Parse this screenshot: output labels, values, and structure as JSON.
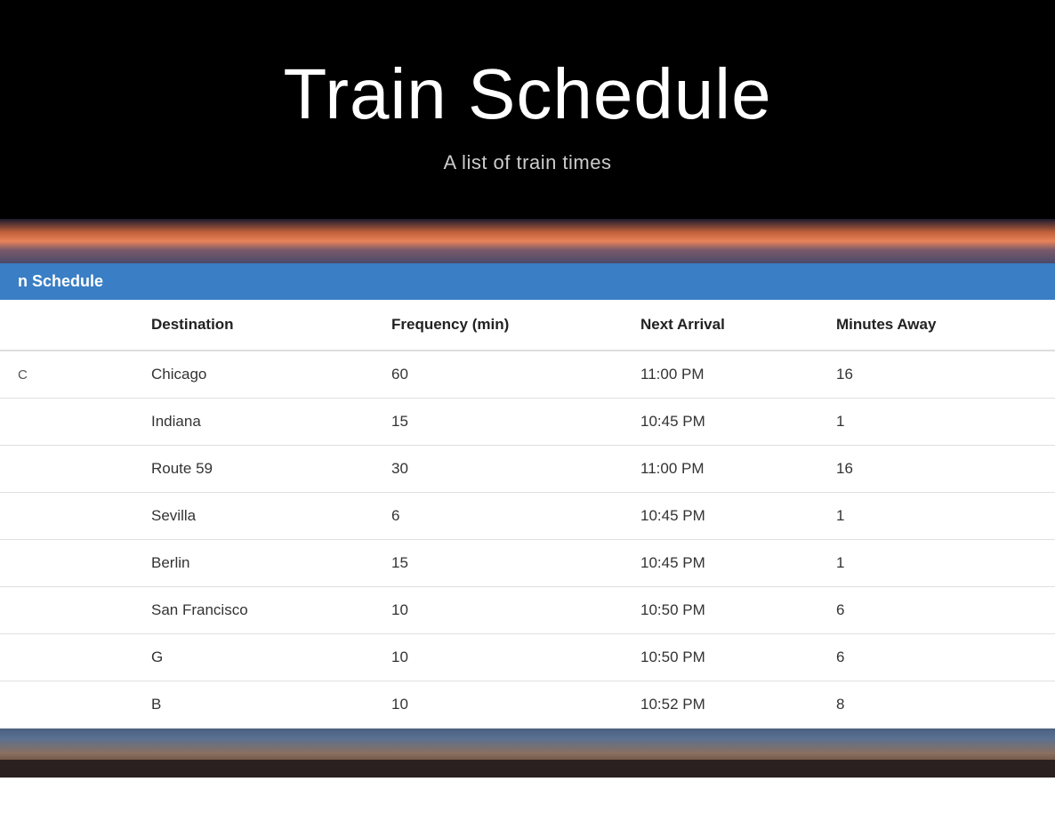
{
  "hero": {
    "title": "Train Schedule",
    "subtitle": "A list of train times"
  },
  "nav": {
    "label": "n Schedule"
  },
  "table": {
    "columns": [
      "",
      "Destination",
      "Frequency (min)",
      "Next Arrival",
      "Minutes Away"
    ],
    "rows": [
      {
        "name": "C",
        "destination": "Chicago",
        "frequency": "60",
        "next_arrival": "11:00 PM",
        "minutes_away": "16"
      },
      {
        "name": "",
        "destination": "Indiana",
        "frequency": "15",
        "next_arrival": "10:45 PM",
        "minutes_away": "1"
      },
      {
        "name": "",
        "destination": "Route 59",
        "frequency": "30",
        "next_arrival": "11:00 PM",
        "minutes_away": "16"
      },
      {
        "name": "",
        "destination": "Sevilla",
        "frequency": "6",
        "next_arrival": "10:45 PM",
        "minutes_away": "1"
      },
      {
        "name": "",
        "destination": "Berlin",
        "frequency": "15",
        "next_arrival": "10:45 PM",
        "minutes_away": "1"
      },
      {
        "name": "",
        "destination": "San Francisco",
        "frequency": "10",
        "next_arrival": "10:50 PM",
        "minutes_away": "6"
      },
      {
        "name": "",
        "destination": "G",
        "frequency": "10",
        "next_arrival": "10:50 PM",
        "minutes_away": "6"
      },
      {
        "name": "",
        "destination": "B",
        "frequency": "10",
        "next_arrival": "10:52 PM",
        "minutes_away": "8"
      }
    ]
  }
}
